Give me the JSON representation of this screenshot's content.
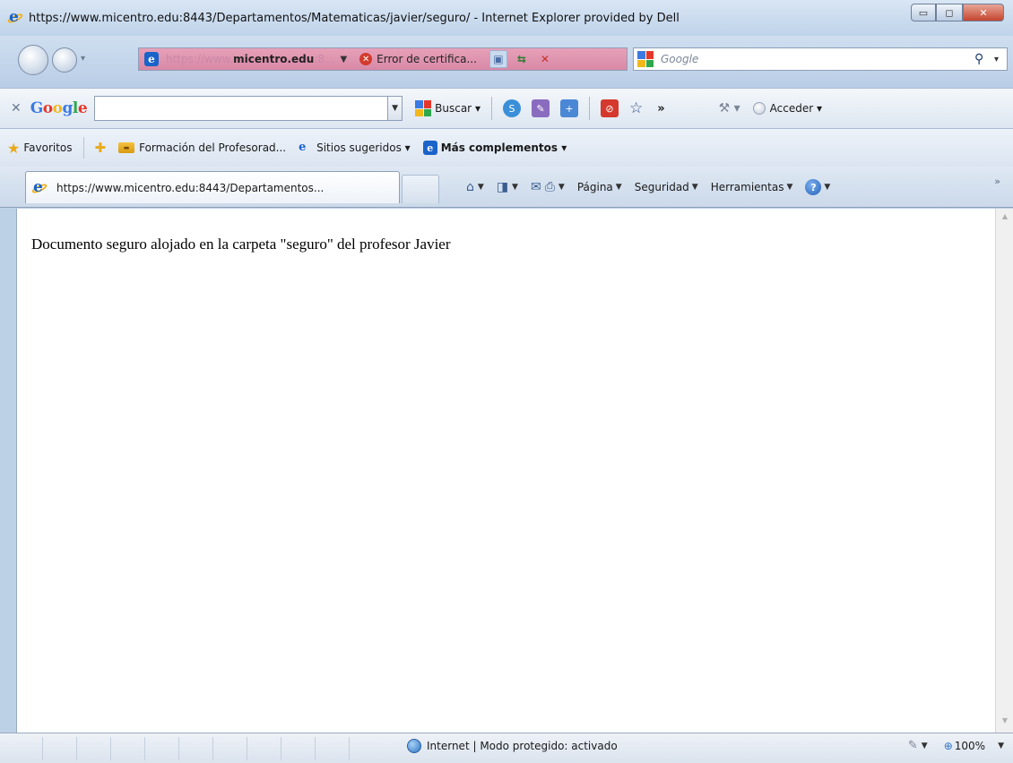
{
  "window": {
    "title": "https://www.micentro.edu:8443/Departamentos/Matematicas/javier/seguro/ - Internet Explorer provided by Dell",
    "minimize_label": "▭",
    "maximize_label": "◻",
    "close_label": "✕"
  },
  "address_bar": {
    "url_scheme": "https://www.",
    "url_host": "micentro.edu",
    "url_tail": ":8...",
    "certificate_error": "Error de certifica..."
  },
  "search_box": {
    "placeholder": "Google"
  },
  "google_toolbar": {
    "brand_letters": [
      "G",
      "o",
      "o",
      "g",
      "l",
      "e"
    ],
    "search_button": "Buscar",
    "more_label": "»",
    "sign_in": "Acceder"
  },
  "favorites_bar": {
    "favorites_label": "Favoritos",
    "items": [
      {
        "label": "Formación del Profesorad...",
        "icon": "badge-icon"
      },
      {
        "label": "Sitios sugeridos ▾",
        "icon": "ie-icon"
      },
      {
        "label": "Más complementos ▾",
        "icon": "ie-box-icon"
      }
    ]
  },
  "tab": {
    "title": "https://www.micentro.edu:8443/Departamentos..."
  },
  "command_bar": {
    "page": "Página",
    "safety": "Seguridad",
    "tools": "Herramientas",
    "help_label": "?",
    "overflow": "»"
  },
  "content": {
    "text": "Documento seguro alojado en la carpeta \"seguro\" del profesor Javier"
  },
  "status_bar": {
    "zone": "Internet | Modo protegido: activado",
    "zoom": "100%"
  },
  "colors": {
    "address_bar_error": "#d889a6",
    "chrome_blue": "#bcd0e6",
    "close_button": "#c4452e"
  }
}
